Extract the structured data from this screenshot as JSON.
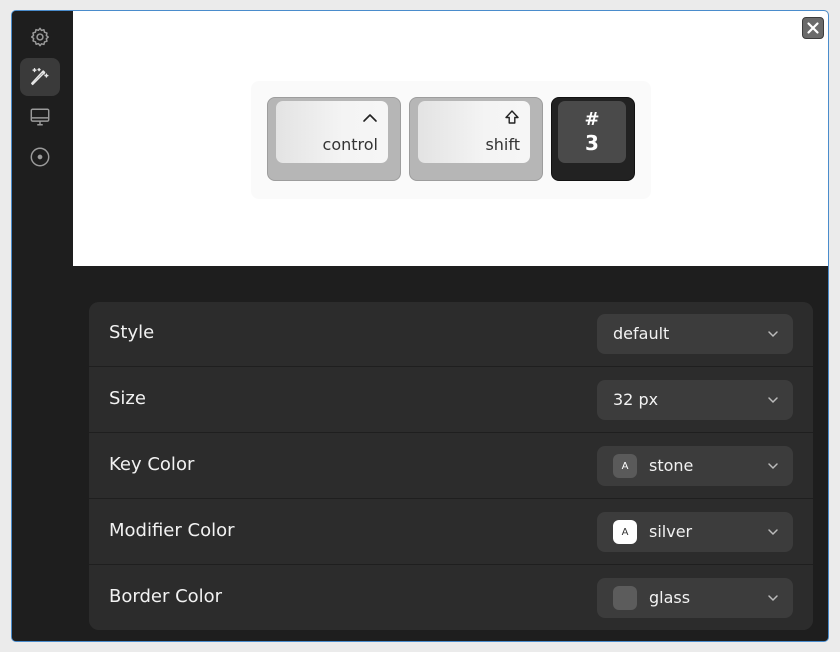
{
  "preview": {
    "keys": [
      {
        "label": "control",
        "symbol": "^"
      },
      {
        "label": "shift",
        "symbol": "⇧"
      },
      {
        "top": "#",
        "bottom": "3"
      }
    ]
  },
  "settings": {
    "rows": [
      {
        "label": "Style",
        "value": "default"
      },
      {
        "label": "Size",
        "value": "32 px"
      },
      {
        "label": "Key Color",
        "value": "stone",
        "swatch_text": "A",
        "swatch_color": "#5a5a5a",
        "swatch_text_color": "#ffffff"
      },
      {
        "label": "Modifier Color",
        "value": "silver",
        "swatch_text": "A",
        "swatch_color": "#ffffff",
        "swatch_text_color": "#333333"
      },
      {
        "label": "Border Color",
        "value": "glass",
        "swatch_color": "#5c5c5c"
      }
    ]
  },
  "sidebar": {
    "items": [
      {
        "icon": "gear-icon",
        "active": false
      },
      {
        "icon": "magic-wand-icon",
        "active": true
      },
      {
        "icon": "monitor-icon",
        "active": false
      },
      {
        "icon": "disc-icon",
        "active": false
      }
    ]
  },
  "colors": {
    "accent_border": "#4a8ccc",
    "sidebar_bg": "#1e1e1e",
    "panel_bg": "#2c2c2c",
    "dropdown_bg": "#3c3c3c"
  }
}
